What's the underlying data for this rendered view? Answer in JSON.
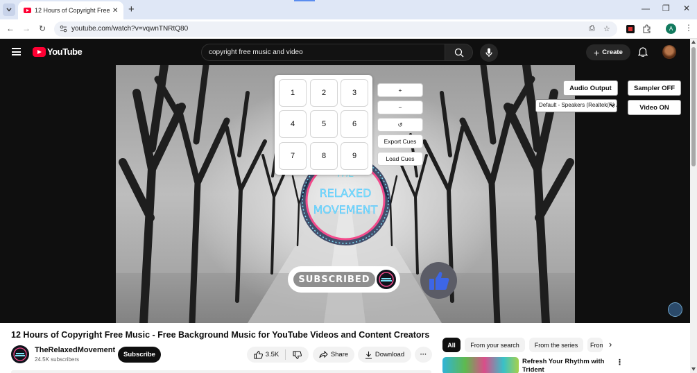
{
  "browser": {
    "tab_title": "12 Hours of Copyright Free Music - Free Background Music for YouTube Videos and Content Creators",
    "url": "youtube.com/watch?v=vqwnTNRtQ80",
    "profile_letter": "A"
  },
  "youtube": {
    "logo_text": "YouTube",
    "search_value": "copyright free music and video",
    "create_label": "Create"
  },
  "overlay": {
    "pads": [
      "1",
      "2",
      "3",
      "4",
      "5",
      "6",
      "7",
      "8",
      "9"
    ],
    "plus": "+",
    "minus": "−",
    "reset": "↺",
    "export_cues": "Export Cues",
    "load_cues": "Load Cues",
    "audio_output": "Audio Output",
    "sampler": "Sampler OFF",
    "video": "Video ON",
    "output_device": "Default - Speakers (Realtek(R) Audio)"
  },
  "video_art": {
    "logo_line1": "THE",
    "logo_line2": "RELAXED",
    "logo_line3": "MOVEMENT",
    "subscribed_text": "SUBSCRIBED"
  },
  "video_info": {
    "title": "12 Hours of Copyright Free Music - Free Background Music for YouTube Videos and Content Creators",
    "channel_name": "TheRelaxedMovement",
    "channel_subs": "24.5K subscribers",
    "subscribe_label": "Subscribe",
    "likes": "3.5K",
    "share_label": "Share",
    "download_label": "Download",
    "more": "···"
  },
  "chips": [
    {
      "label": "All",
      "active": true
    },
    {
      "label": "From your search",
      "active": false
    },
    {
      "label": "From the series",
      "active": false
    },
    {
      "label": "From TheRelaxedMovement",
      "active": false
    }
  ],
  "recommendation": {
    "title": "Refresh Your Rhythm with Trident"
  },
  "colors": {
    "youtube_red": "#ff0033",
    "header_bg": "#0f0f0f",
    "like_blue": "#3d66e6"
  }
}
